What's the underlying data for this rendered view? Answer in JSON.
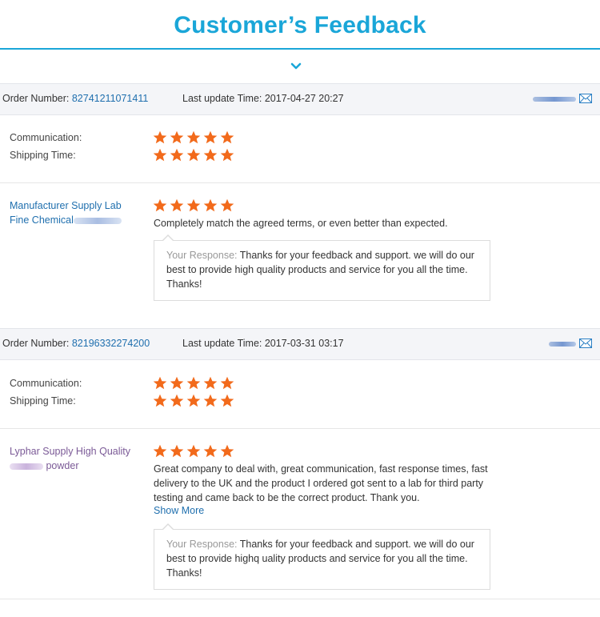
{
  "page": {
    "title": "Customer’s Feedback",
    "accent_color": "#1aa6d8",
    "star_color": "#f26a1b"
  },
  "feedbacks": [
    {
      "order_label": "Order Number:",
      "order_number": "82741211071411",
      "update_label": "Last update Time:",
      "update_time": "2017-04-27 20:27",
      "ratings": [
        {
          "label": "Communication:",
          "stars": 5
        },
        {
          "label": "Shipping Time:",
          "stars": 5
        }
      ],
      "product_line1": "Manufacturer Supply Lab",
      "product_line2": "Fine Chemical",
      "product_stars": 5,
      "comment": "Completely match the agreed terms, or even better than expected.",
      "response_label": "Your Response:",
      "response_text": " Thanks for your feedback and support. we will do our best to provide high quality products and service for you all the time. Thanks!"
    },
    {
      "order_label": "Order Number:",
      "order_number": "82196332274200",
      "update_label": "Last update Time:",
      "update_time": "2017-03-31 03:17",
      "ratings": [
        {
          "label": "Communication:",
          "stars": 5
        },
        {
          "label": "Shipping Time:",
          "stars": 5
        }
      ],
      "product_line1": "Lyphar Supply High Quality",
      "product_line2": "powder",
      "product_stars": 5,
      "comment": "Great company to deal with, great communication, fast response times, fast delivery to the UK and the product I ordered got sent to a lab for third party testing and came back to be the correct product. Thank you.",
      "show_more": "Show More",
      "response_label": "Your Response:",
      "response_text": " Thanks for your feedback and support. we will do our best to provide highq uality products and service for you all the time. Thanks!"
    }
  ]
}
